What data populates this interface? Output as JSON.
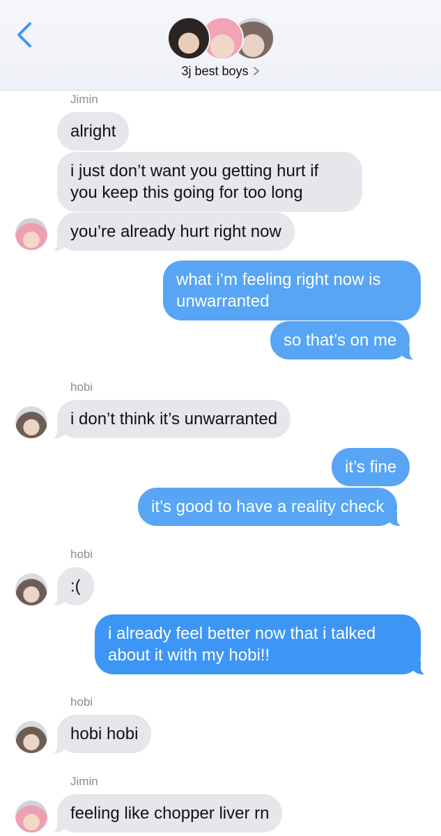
{
  "header": {
    "back_icon": "chevron-left-icon",
    "group_name": "3j best boys",
    "accent_color": "#3d96f5"
  },
  "messages": [
    {
      "sender": "Jimin",
      "text": "alright",
      "direction": "incoming"
    },
    {
      "text": "i just don’t want you getting hurt if you keep this going for too long",
      "direction": "incoming"
    },
    {
      "text": "you’re already hurt right now",
      "direction": "incoming",
      "avatar": "jimin"
    },
    {
      "text": "what i’m feeling right now is unwarranted",
      "direction": "outgoing"
    },
    {
      "text": "so that’s on me",
      "direction": "outgoing"
    },
    {
      "sender": "hobi",
      "text": "i don’t think it’s unwarranted",
      "direction": "incoming",
      "avatar": "hobi"
    },
    {
      "text": "it’s fine",
      "direction": "outgoing"
    },
    {
      "text": "it’s good to have a reality check",
      "direction": "outgoing"
    },
    {
      "sender": "hobi",
      "text": ":(",
      "direction": "incoming",
      "avatar": "hobi"
    },
    {
      "text": "i already feel better now that i talked about it with my hobi!!",
      "direction": "outgoing"
    },
    {
      "sender": "hobi",
      "text": "hobi hobi",
      "direction": "incoming",
      "avatar": "hobi"
    },
    {
      "sender": "Jimin",
      "text": "feeling like chopper liver rn",
      "direction": "incoming",
      "avatar": "jimin"
    }
  ]
}
